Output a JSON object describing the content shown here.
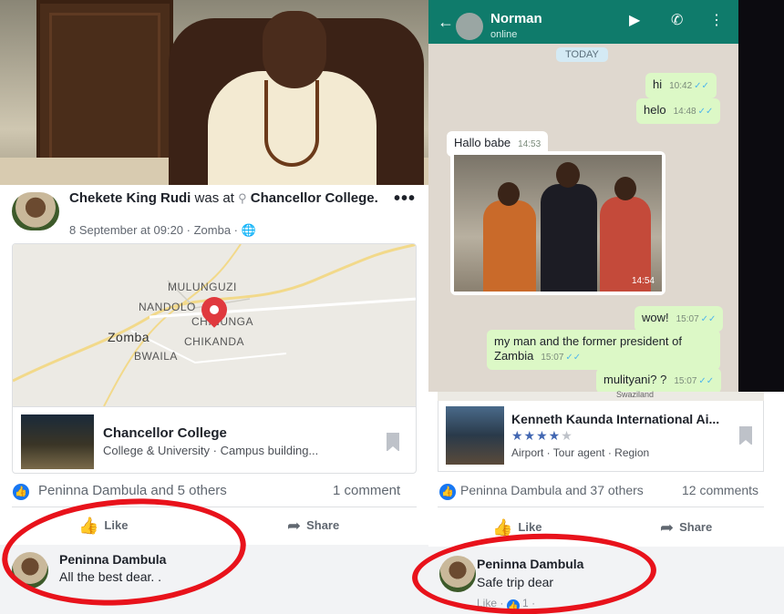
{
  "left_post": {
    "author": "Chekete King Rudi",
    "was_at": "was at",
    "location": "Chancellor College.",
    "meta": "8 September at 09:20 · Zomba · ",
    "more": "•••",
    "map_labels": [
      "MULUNGUZI",
      "NANDOLO",
      "CHINUNGA",
      "Zomba",
      "CHIKANDA",
      "BWAILA"
    ],
    "place_title": "Chancellor College",
    "place_sub": "College & University · Campus building...",
    "reactions_text": "Peninna Dambula and 5 others",
    "comment_count": "1 comment",
    "like_label": "Like",
    "share_label": "Share",
    "comment": {
      "name": "Peninna Dambula",
      "text": "All the best dear. ."
    }
  },
  "whatsapp": {
    "contact": "Norman",
    "status": "online",
    "date_chip": "TODAY",
    "messages": [
      {
        "text": "hi",
        "time": "10:42",
        "dir": "out"
      },
      {
        "text": "helo",
        "time": "14:48",
        "dir": "out"
      },
      {
        "text": "Hallo babe",
        "time": "14:53",
        "dir": "in"
      },
      {
        "text": "",
        "time": "14:54",
        "dir": "in"
      },
      {
        "text": "wow!",
        "time": "15:07",
        "dir": "out"
      },
      {
        "text": "my man and the former  president of Zambia",
        "time": "15:07",
        "dir": "out"
      },
      {
        "text": "mulityani? ?",
        "time": "15:07",
        "dir": "out"
      }
    ],
    "map_fragment": "Swaziland"
  },
  "right_post": {
    "place_title": "Kenneth Kaunda International Ai...",
    "rating": 3.5,
    "stars": "★★★★",
    "stars_off": "★",
    "place_sub": "Airport · Tour agent · Region",
    "reactions_text": "Peninna Dambula and 37 others",
    "comment_count": "12 comments",
    "like_label": "Like",
    "share_label": "Share",
    "comment": {
      "name": "Peninna Dambula",
      "text": "Safe trip dear",
      "like_link": "Like ·",
      "like_count": "1",
      "trail": "·"
    }
  },
  "colors": {
    "facebook_blue": "#1877f2",
    "whatsapp_green": "#0f7b6b",
    "annotation_red": "#e8121b"
  }
}
